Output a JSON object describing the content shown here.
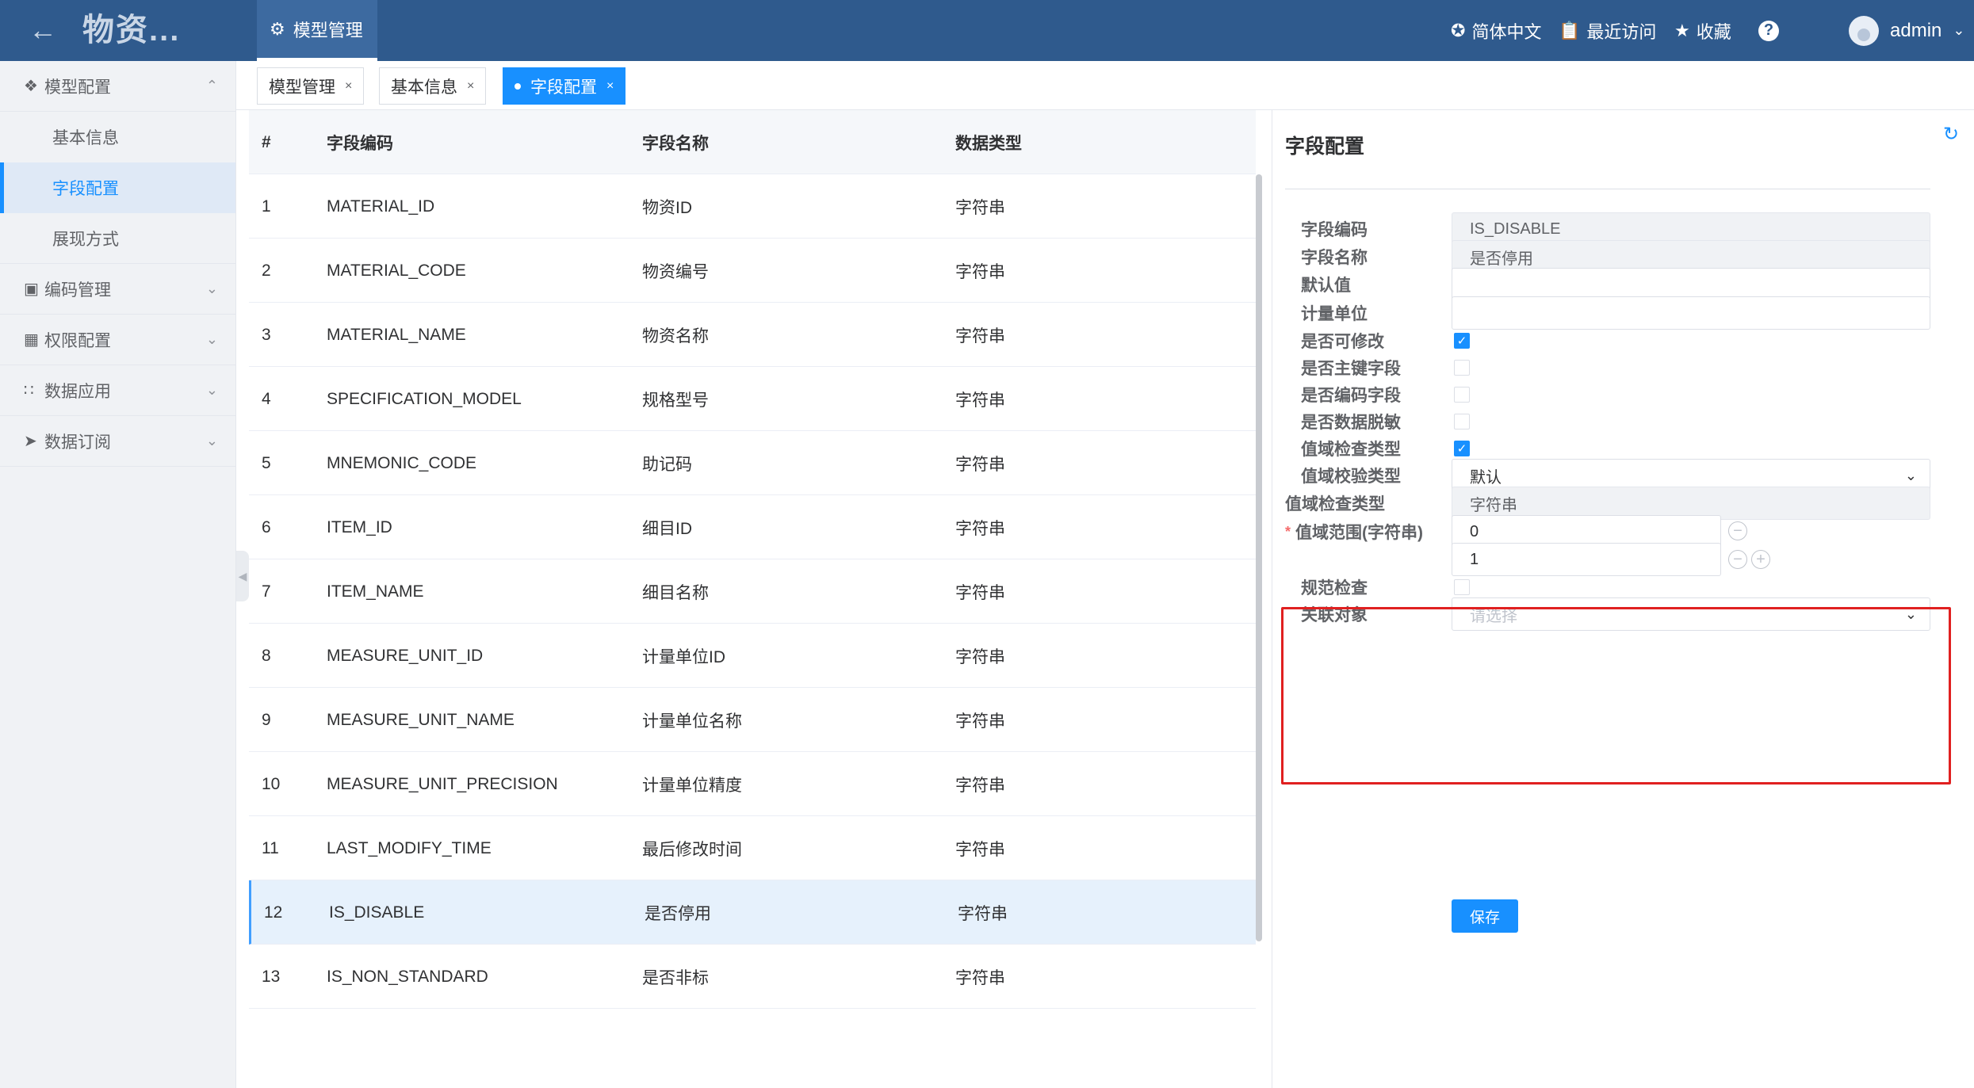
{
  "header": {
    "back_icon": "arrow-left-icon",
    "app_title": "物资...",
    "active_module": "模型管理",
    "language": "简体中文",
    "recent": "最近访问",
    "favorites": "收藏",
    "help": "?",
    "user": "admin"
  },
  "sidebar": {
    "groups": [
      {
        "label": "模型配置",
        "icon": "cube-icon",
        "expanded": true,
        "items": [
          {
            "label": "基本信息"
          },
          {
            "label": "字段配置",
            "active": true
          },
          {
            "label": "展现方式"
          }
        ]
      },
      {
        "label": "编码管理",
        "icon": "code-icon"
      },
      {
        "label": "权限配置",
        "icon": "lock-icon"
      },
      {
        "label": "数据应用",
        "icon": "grid-icon"
      },
      {
        "label": "数据订阅",
        "icon": "send-icon"
      }
    ]
  },
  "tabs": [
    {
      "label": "模型管理"
    },
    {
      "label": "基本信息"
    },
    {
      "label": "字段配置",
      "active": true
    }
  ],
  "table": {
    "columns": [
      "#",
      "字段编码",
      "字段名称",
      "数据类型"
    ],
    "rows": [
      {
        "no": "1",
        "code": "MATERIAL_ID",
        "name": "物资ID",
        "type": "字符串"
      },
      {
        "no": "2",
        "code": "MATERIAL_CODE",
        "name": "物资编号",
        "type": "字符串"
      },
      {
        "no": "3",
        "code": "MATERIAL_NAME",
        "name": "物资名称",
        "type": "字符串"
      },
      {
        "no": "4",
        "code": "SPECIFICATION_MODEL",
        "name": "规格型号",
        "type": "字符串"
      },
      {
        "no": "5",
        "code": "MNEMONIC_CODE",
        "name": "助记码",
        "type": "字符串"
      },
      {
        "no": "6",
        "code": "ITEM_ID",
        "name": "细目ID",
        "type": "字符串"
      },
      {
        "no": "7",
        "code": "ITEM_NAME",
        "name": "细目名称",
        "type": "字符串"
      },
      {
        "no": "8",
        "code": "MEASURE_UNIT_ID",
        "name": "计量单位ID",
        "type": "字符串"
      },
      {
        "no": "9",
        "code": "MEASURE_UNIT_NAME",
        "name": "计量单位名称",
        "type": "字符串"
      },
      {
        "no": "10",
        "code": "MEASURE_UNIT_PRECISION",
        "name": "计量单位精度",
        "type": "字符串"
      },
      {
        "no": "11",
        "code": "LAST_MODIFY_TIME",
        "name": "最后修改时间",
        "type": "字符串"
      },
      {
        "no": "12",
        "code": "IS_DISABLE",
        "name": "是否停用",
        "type": "字符串",
        "selected": true
      },
      {
        "no": "13",
        "code": "IS_NON_STANDARD",
        "name": "是否非标",
        "type": "字符串"
      }
    ]
  },
  "panel": {
    "title": "字段配置",
    "refresh_icon": "refresh-icon",
    "field_code_label": "字段编码",
    "field_code_value": "IS_DISABLE",
    "field_name_label": "字段名称",
    "field_name_value": "是否停用",
    "default_label": "默认值",
    "default_value": "",
    "unit_label": "计量单位",
    "unit_value": "",
    "editable_label": "是否可修改",
    "editable": true,
    "primary_label": "是否主键字段",
    "primary": false,
    "coding_label": "是否编码字段",
    "coding": false,
    "masking_label": "是否数据脱敏",
    "masking": false,
    "range_check_label": "值域检查类型",
    "range_check": true,
    "validate_type_label": "值域校验类型",
    "validate_type_value": "默认",
    "check_type_label": "值域检查类型",
    "check_type_value": "字符串",
    "range_label": "值域范围(字符串)",
    "range_values": [
      "0",
      "1"
    ],
    "spec_check_label": "规范检查",
    "spec_check": false,
    "related_label": "关联对象",
    "related_placeholder": "请选择",
    "save_label": "保存"
  },
  "colors": {
    "header_bg": "#2f5a8d",
    "accent": "#1890ff",
    "highlight_border": "#e02020"
  }
}
